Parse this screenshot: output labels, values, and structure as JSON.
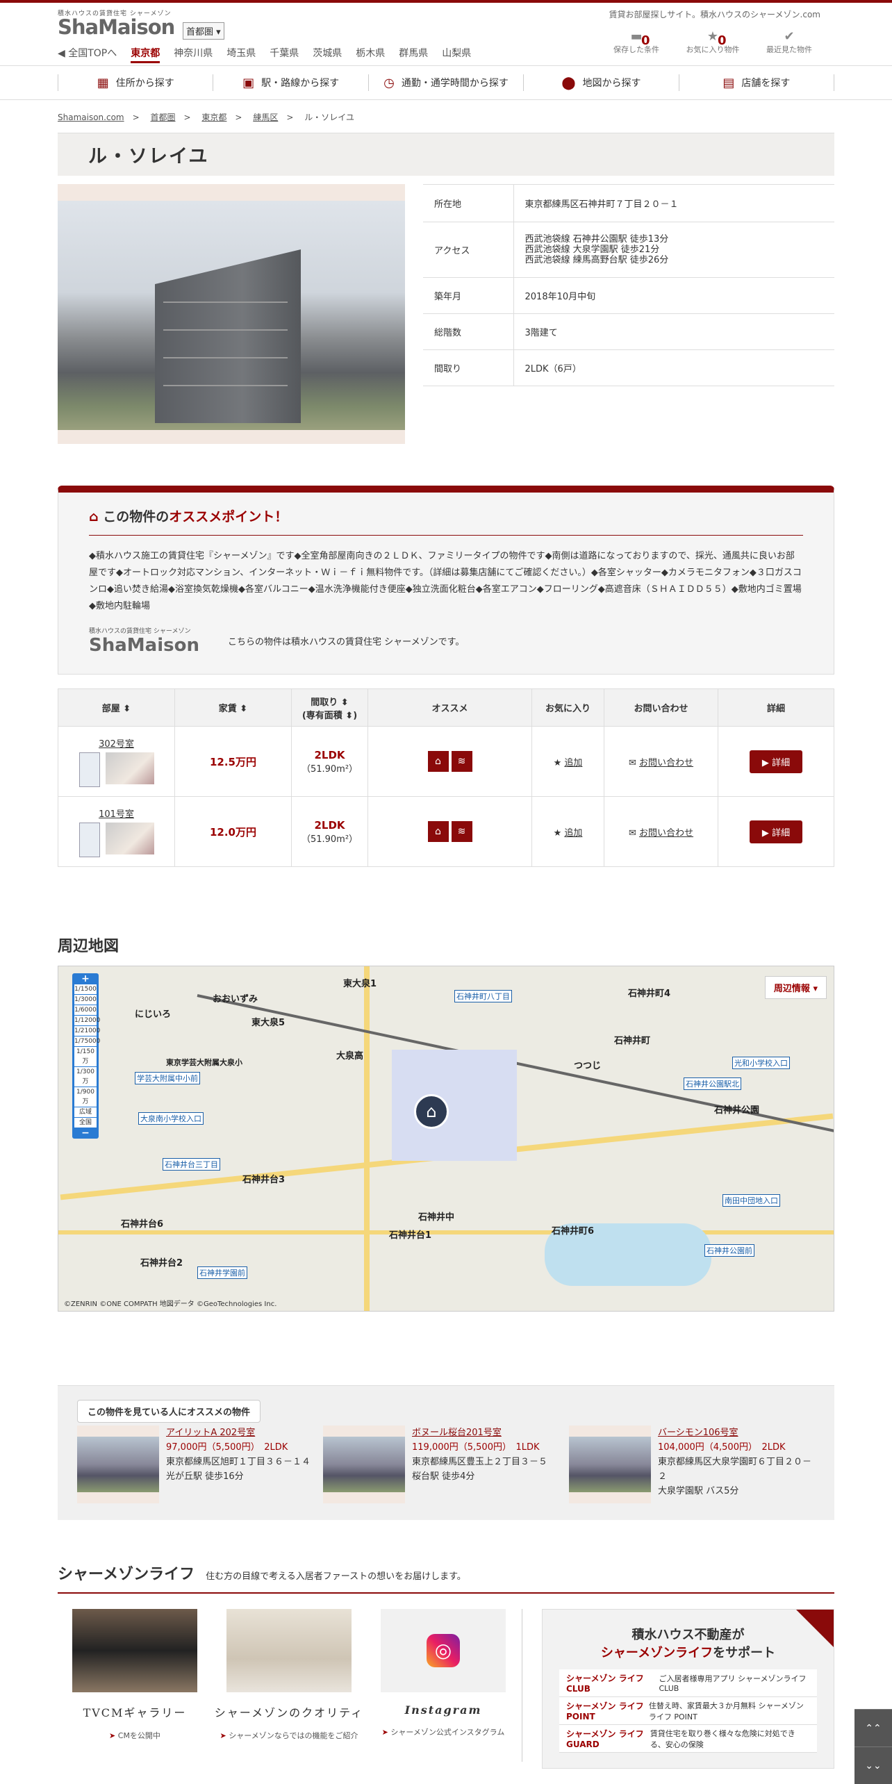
{
  "header": {
    "logo_sub": "積水ハウスの賃貸住宅 シャーメゾン",
    "logo": "ShaMaison",
    "region": "首都圏",
    "tagline": "賃貸お部屋探しサイト。積水ハウスのシャーメゾン.com",
    "icons": [
      {
        "label": "保存した条件",
        "count": "0",
        "icon": "folder-icon"
      },
      {
        "label": "お気に入り物件",
        "count": "0",
        "icon": "star-icon"
      },
      {
        "label": "最近見た物件",
        "count": "",
        "icon": "check-icon"
      }
    ],
    "prefs": [
      "◀ 全国TOPへ",
      "東京都",
      "神奈川県",
      "埼玉県",
      "千葉県",
      "茨城県",
      "栃木県",
      "群馬県",
      "山梨県"
    ]
  },
  "search_nav": [
    {
      "label": "住所から探す",
      "icon": "building-icon"
    },
    {
      "label": "駅・路線から探す",
      "icon": "train-icon"
    },
    {
      "label": "通勤・通学時間から探す",
      "icon": "clock-icon"
    },
    {
      "label": "地図から探す",
      "icon": "pin-icon"
    },
    {
      "label": "店舗を探す",
      "icon": "store-icon"
    }
  ],
  "breadcrumb": [
    "Shamaison.com",
    ">",
    "首都圏",
    ">",
    "東京都",
    ">",
    "練馬区",
    ">",
    "ル・ソレイユ"
  ],
  "property": {
    "name": "ル・ソレイユ",
    "specs": [
      {
        "k": "所在地",
        "v": "東京都練馬区石神井町７丁目２０－１"
      },
      {
        "k": "アクセス",
        "v": "西武池袋線 石神井公園駅 徒歩13分\n西武池袋線 大泉学園駅 徒歩21分\n西武池袋線 練馬高野台駅 徒歩26分"
      },
      {
        "k": "築年月",
        "v": "2018年10月中旬"
      },
      {
        "k": "総階数",
        "v": "3階建て"
      },
      {
        "k": "間取り",
        "v": "2LDK（6戸）"
      }
    ]
  },
  "osusume": {
    "title_a": "この物件の",
    "title_b": "オススメポイント！",
    "text": "◆積水ハウス施工の賃貸住宅『シャーメゾン』です◆全室角部屋南向きの２ＬＤＫ、ファミリータイプの物件です◆南側は道路になっておりますので、採光、通風共に良いお部屋です◆オートロック対応マンション、インターネット・Ｗｉ－ｆｉ無料物件です。（詳細は募集店舗にてご確認ください。）◆各室シャッター◆カメラモニタフォン◆３口ガスコンロ◆追い焚き給湯◆浴室換気乾燥機◆各室バルコニー◆温水洗浄機能付き便座◆独立洗面化粧台◆各室エアコン◆フローリング◆高遮音床（ＳＨＡＩＤＤ５５）◆敷地内ゴミ置場◆敷地内駐輪場",
    "logo_sub": "積水ハウスの賃貸住宅 シャーメゾン",
    "logo": "ShaMaison",
    "foot": "こちらの物件は積水ハウスの賃貸住宅 シャーメゾンです。"
  },
  "rooms": {
    "headers": [
      "部屋 ⬍",
      "家賃 ⬍",
      "間取り ⬍\n(専有面積 ⬍)",
      "オススメ",
      "お気に入り",
      "お問い合わせ",
      "詳細"
    ],
    "rows": [
      {
        "name": "302号室",
        "rent": "12.5万円",
        "layout": "2LDK",
        "area": "（51.90m²）",
        "fav": "追加",
        "inquiry": "お問い合わせ",
        "detail": "詳細"
      },
      {
        "name": "101号室",
        "rent": "12.0万円",
        "layout": "2LDK",
        "area": "（51.90m²）",
        "fav": "追加",
        "inquiry": "お問い合わせ",
        "detail": "詳細"
      }
    ]
  },
  "map": {
    "title": "周辺地図",
    "menu": "周辺情報",
    "zoom": [
      "+",
      "1/1500",
      "1/3000",
      "1/6000",
      "1/12000",
      "1/21000",
      "1/75000",
      "1/150万",
      "1/300万",
      "1/900万",
      "広域",
      "全国",
      "−"
    ],
    "copyright": "©ZENRIN ©ONE COMPATH 地図データ ©GeoTechnologies Inc.",
    "labels": [
      "東大泉1",
      "東大泉5",
      "大泉高",
      "石神井町4",
      "石神井町",
      "石神井台3",
      "石神井台1",
      "石神井台6",
      "石神井台2",
      "石神井町6",
      "石神井公園",
      "東京学芸大附属大泉小",
      "石神井中",
      "おおいずみ",
      "にじいろ",
      "つつじ"
    ],
    "stations": [
      "石神井町八丁目",
      "学芸大附属中小前",
      "大泉南小学校入口",
      "石神井台三丁目",
      "石神井学園前",
      "石神井公園駅北",
      "光和小学校入口",
      "南田中団地入口",
      "石神井公園前"
    ]
  },
  "recommend": {
    "title": "この物件を見ている人にオススメの物件",
    "items": [
      {
        "name": "アイリットA 202号室",
        "price": "97,000円（5,500円）",
        "layout": "2LDK",
        "addr": "東京都練馬区旭町１丁目３６－１４",
        "access": "光が丘駅 徒歩16分"
      },
      {
        "name": "ボヌール桜台201号室",
        "price": "119,000円（5,500円）",
        "layout": "1LDK",
        "addr": "東京都練馬区豊玉上２丁目３－５",
        "access": "桜台駅 徒歩4分"
      },
      {
        "name": "バーシモン106号室",
        "price": "104,000円（4,500円）",
        "layout": "2LDK",
        "addr": "東京都練馬区大泉学園町６丁目２０－２",
        "access": "大泉学園駅 バス5分"
      }
    ]
  },
  "life": {
    "title": "シャーメゾンライフ",
    "sub": "住む方の目線で考える入居者ファーストの想いをお届けします。",
    "cards": [
      {
        "title": "TVCMギャラリー",
        "sub": "CMを公開中"
      },
      {
        "title": "シャーメゾンのクオリティ",
        "sub": "シャーメゾンならではの機能をご紹介"
      },
      {
        "title": "Instagram",
        "sub": "シャーメゾン公式インスタグラム"
      }
    ],
    "support": {
      "line1": "積水ハウス不動産が",
      "line2a": "シャーメゾンライフ",
      "line2b": "をサポート",
      "rows": [
        {
          "l": "シャーメゾン ライフ CLUB",
          "t": "ご入居者様専用アプリ シャーメゾンライフ CLUB"
        },
        {
          "l": "シャーメゾン ライフ POINT",
          "t": "住替え時、家賃最大３か月無料 シャーメゾンライフ POINT"
        },
        {
          "l": "シャーメゾン ライフ GUARD",
          "t": "賃貸住宅を取り巻く様々な危険に対処できる、安心の保険"
        }
      ]
    }
  },
  "scroll": [
    "⌃⌃",
    "⌄⌄"
  ],
  "colors": {
    "brand": "#8a0a0a",
    "accent": "#9a0000"
  }
}
